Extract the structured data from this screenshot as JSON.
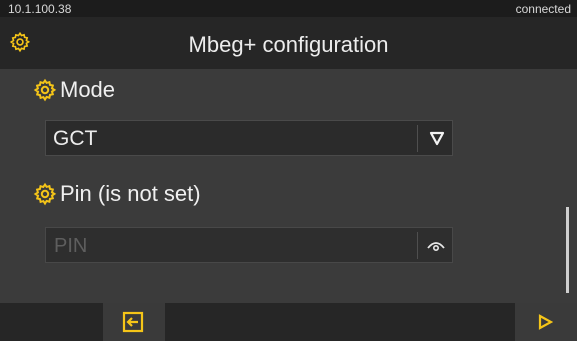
{
  "status_bar": {
    "ip_address": "10.1.100.38",
    "connection_status": "connected"
  },
  "header": {
    "title": "Mbeg+ configuration",
    "icon": "gear-icon"
  },
  "form": {
    "mode": {
      "label": "Mode",
      "icon": "gear-icon",
      "selected_value": "GCT"
    },
    "pin": {
      "label": "Pin (is not set)",
      "icon": "gear-icon",
      "value": "",
      "placeholder": "PIN"
    }
  },
  "footer": {
    "back_icon": "exit-icon",
    "next_icon": "play-icon"
  },
  "colors": {
    "accent": "#f5c518",
    "text": "#ececec",
    "background": "#3b3b3b",
    "bar": "#262626"
  }
}
